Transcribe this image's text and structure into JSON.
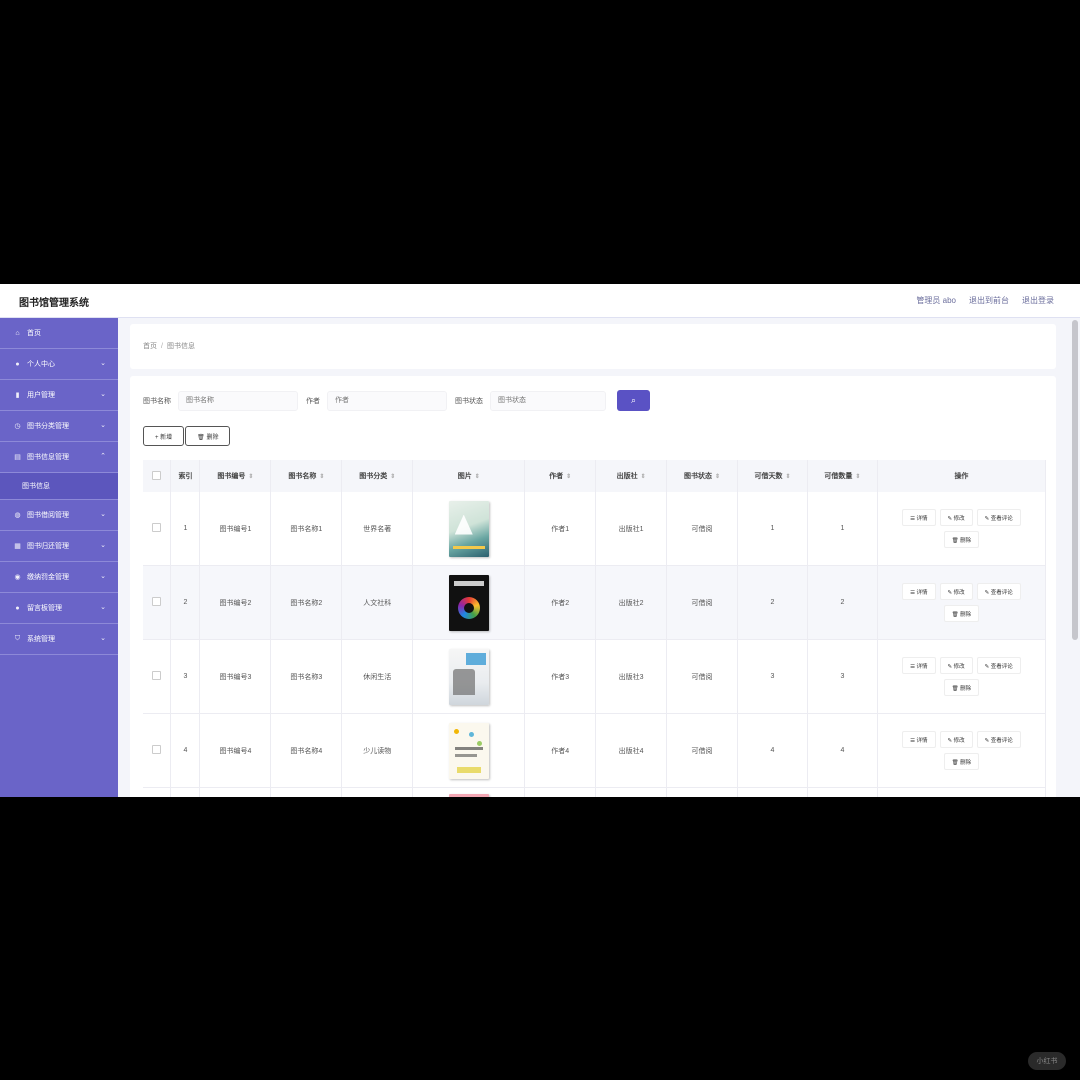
{
  "app": {
    "title": "图书馆管理系统"
  },
  "topbar": {
    "admin": "管理员 abo",
    "to_front": "退出到前台",
    "logout": "退出登录"
  },
  "sidebar": {
    "items": [
      {
        "label": "首页",
        "icon": "home-icon"
      },
      {
        "label": "个人中心",
        "icon": "user-icon"
      },
      {
        "label": "用户管理",
        "icon": "bar-chart-icon"
      },
      {
        "label": "图书分类管理",
        "icon": "clock-icon"
      },
      {
        "label": "图书信息管理",
        "icon": "book-icon"
      },
      {
        "label": "图书借阅管理",
        "icon": "globe-icon"
      },
      {
        "label": "图书归还管理",
        "icon": "grid-icon"
      },
      {
        "label": "缴纳罚金管理",
        "icon": "coin-icon"
      },
      {
        "label": "留言板管理",
        "icon": "user-icon"
      },
      {
        "label": "系统管理",
        "icon": "shield-icon"
      }
    ],
    "sub_item": "图书信息"
  },
  "breadcrumb": {
    "home": "首页",
    "sep": "/",
    "current": "图书信息"
  },
  "search": {
    "name_label": "图书名称",
    "name_placeholder": "图书名称",
    "author_label": "作者",
    "author_placeholder": "作者",
    "status_label": "图书状态",
    "status_placeholder": "图书状态"
  },
  "actions": {
    "add": "+ 新增",
    "delete": "🗑 删除"
  },
  "table": {
    "headers": [
      "索引",
      "图书编号",
      "图书名称",
      "图书分类",
      "图片",
      "作者",
      "出版社",
      "图书状态",
      "可借天数",
      "可借数量",
      "操作"
    ],
    "sort_icon": "⇕",
    "rows": [
      {
        "index": "1",
        "code": "图书编号1",
        "name": "图书名称1",
        "category": "世界名著",
        "author": "作者1",
        "publisher": "出版社1",
        "status": "可借阅",
        "days": "1",
        "qty": "1"
      },
      {
        "index": "2",
        "code": "图书编号2",
        "name": "图书名称2",
        "category": "人文社科",
        "author": "作者2",
        "publisher": "出版社2",
        "status": "可借阅",
        "days": "2",
        "qty": "2"
      },
      {
        "index": "3",
        "code": "图书编号3",
        "name": "图书名称3",
        "category": "休闲生活",
        "author": "作者3",
        "publisher": "出版社3",
        "status": "可借阅",
        "days": "3",
        "qty": "3"
      },
      {
        "index": "4",
        "code": "图书编号4",
        "name": "图书名称4",
        "category": "少儿读物",
        "author": "作者4",
        "publisher": "出版社4",
        "status": "可借阅",
        "days": "4",
        "qty": "4"
      }
    ],
    "op_labels": {
      "detail": "☰ 详情",
      "edit": "✎ 修改",
      "review": "✎ 查看评论",
      "delete": "🗑 删除"
    }
  },
  "watermark": "小红书",
  "colors": {
    "sidebar": "#6a64c8",
    "accent": "#5a52c4"
  }
}
